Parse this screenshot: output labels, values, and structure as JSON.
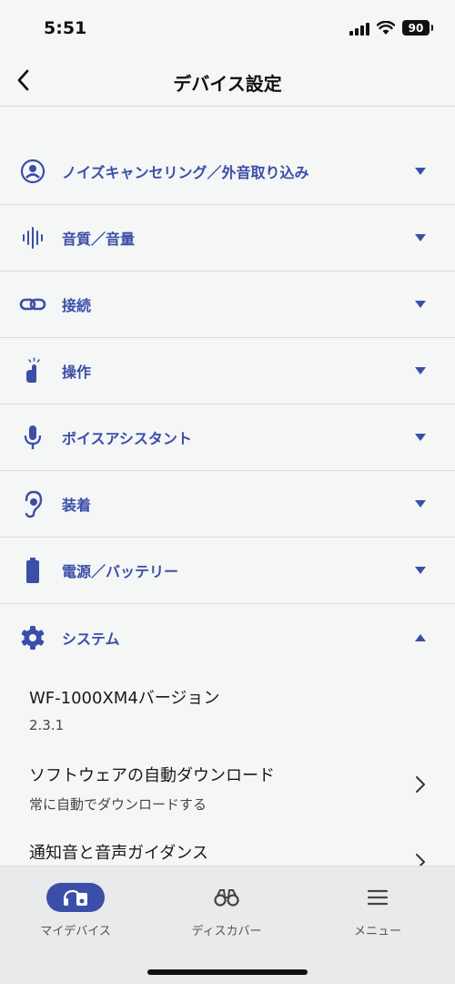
{
  "status_bar": {
    "time": "5:51",
    "battery": "90"
  },
  "header": {
    "title": "デバイス設定",
    "back_icon": "chevron-left-icon"
  },
  "settings": {
    "items": [
      {
        "label": "ノイズキャンセリング／外音取り込み",
        "icon": "noise-cancel-icon",
        "expanded": false
      },
      {
        "label": "音質／音量",
        "icon": "sound-wave-icon",
        "expanded": false
      },
      {
        "label": "接続",
        "icon": "link-icon",
        "expanded": false
      },
      {
        "label": "操作",
        "icon": "touch-icon",
        "expanded": false
      },
      {
        "label": "ボイスアシスタント",
        "icon": "microphone-icon",
        "expanded": false
      },
      {
        "label": "装着",
        "icon": "ear-icon",
        "expanded": false
      },
      {
        "label": "電源／バッテリー",
        "icon": "battery-icon",
        "expanded": false
      },
      {
        "label": "システム",
        "icon": "gear-icon",
        "expanded": true
      }
    ],
    "system": {
      "version_title": "WF-1000XM4バージョン",
      "version_value": "2.3.1",
      "auto_download_title": "ソフトウェアの自動ダウンロード",
      "auto_download_value": "常に自動でダウンロードする",
      "notification_title": "通知音と音声ガイダンス"
    }
  },
  "tabs": [
    {
      "label": "マイデバイス",
      "icon": "my-device-icon",
      "active": true
    },
    {
      "label": "ディスカバー",
      "icon": "binoculars-icon",
      "active": false
    },
    {
      "label": "メニュー",
      "icon": "menu-icon",
      "active": false
    }
  ],
  "colors": {
    "accent": "#3b4fa8",
    "background": "#f5f6f6",
    "tab_bar": "#e9eaeb"
  }
}
